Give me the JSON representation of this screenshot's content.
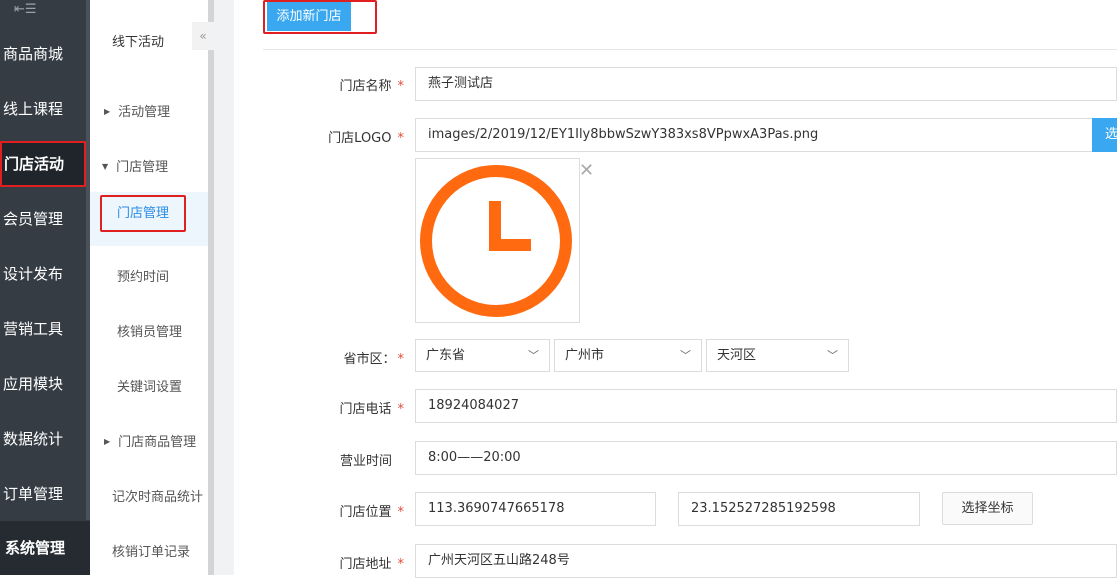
{
  "leftnav": {
    "collapse_icon": "⇤☰",
    "items": [
      {
        "label": "商品商城"
      },
      {
        "label": "线上课程"
      },
      {
        "label": "门店活动"
      },
      {
        "label": "会员管理"
      },
      {
        "label": "设计发布"
      },
      {
        "label": "营销工具"
      },
      {
        "label": "应用模块"
      },
      {
        "label": "数据统计"
      },
      {
        "label": "订单管理"
      },
      {
        "label": "系统管理"
      }
    ]
  },
  "submenu": {
    "title": "线下活动",
    "collapse_glyph": "«",
    "items": [
      {
        "label": "活动管理"
      },
      {
        "label": "门店管理"
      },
      {
        "label": "门店管理"
      },
      {
        "label": "预约时间"
      },
      {
        "label": "核销员管理"
      },
      {
        "label": "关键词设置"
      },
      {
        "label": "门店商品管理"
      },
      {
        "label": "记次时商品统计"
      },
      {
        "label": "核销订单记录"
      }
    ]
  },
  "toolbar": {
    "add_label": "添加新门店"
  },
  "form": {
    "name": {
      "label": "门店名称",
      "value": "燕子测试店"
    },
    "logo": {
      "label": "门店LOGO",
      "value": "images/2/2019/12/EY1Ily8bbwSzwY383xs8VPpwxA3Pas.png",
      "select_label": "选"
    },
    "region": {
      "label": "省市区：",
      "province": "广东省",
      "city": "广州市",
      "district": "天河区"
    },
    "phone": {
      "label": "门店电话",
      "value": "18924084027"
    },
    "hours": {
      "label": "营业时间",
      "value": "8:00——20:00"
    },
    "location": {
      "label": "门店位置",
      "lng": "113.3690747665178",
      "lat": "23.152527285192598",
      "button": "选择坐标"
    },
    "address": {
      "label": "门店地址",
      "value": "广州天河区五山路248号"
    },
    "required_mark": "*"
  },
  "colors": {
    "accent": "#39a8f0",
    "nav_bg": "#353c44",
    "highlight": "#e02020",
    "logo_orange": "#ff6a10"
  },
  "icons": {
    "logo": "clock-icon",
    "close": "close-icon",
    "chevron": "chevron-down-icon"
  }
}
